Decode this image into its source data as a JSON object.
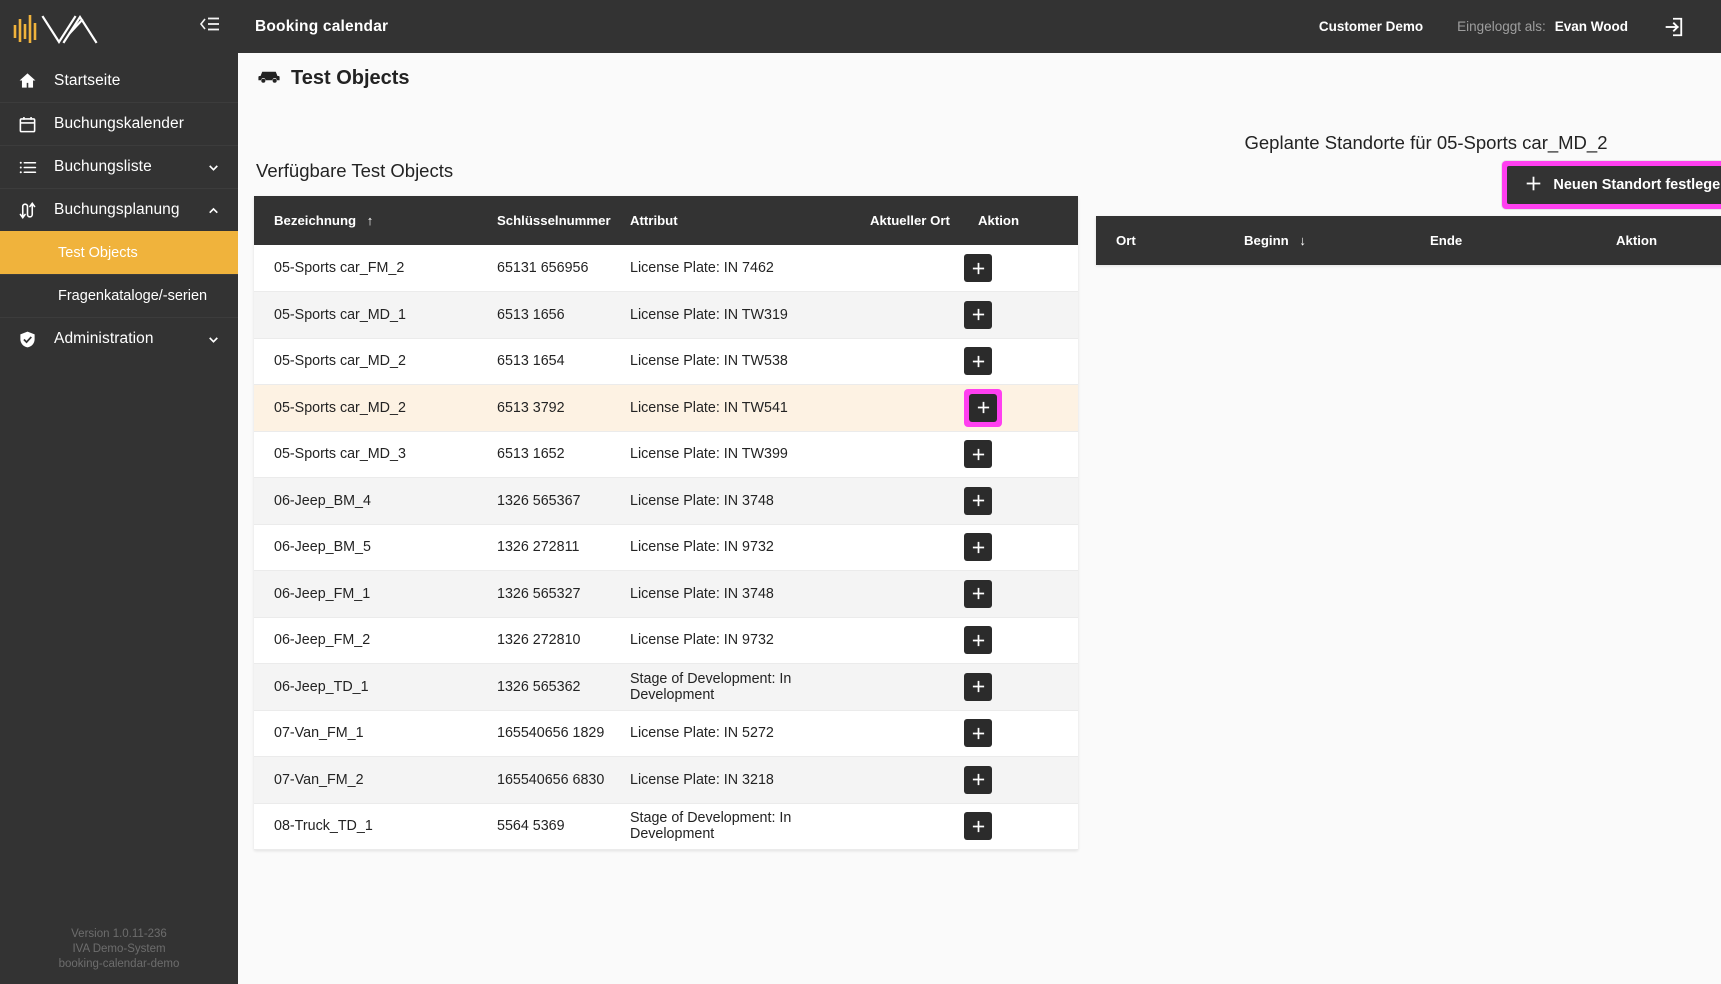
{
  "sidebar": {
    "logo_name": "iva-logo",
    "collapse_icon": "collapse-panel-icon",
    "items": [
      {
        "label": "Startseite",
        "icon": "home-icon",
        "chevron": ""
      },
      {
        "label": "Buchungskalender",
        "icon": "calendar-icon",
        "chevron": ""
      },
      {
        "label": "Buchungsliste",
        "icon": "list-icon",
        "chevron": "chevron-down-icon"
      },
      {
        "label": "Buchungsplanung",
        "icon": "swap-arrows-icon",
        "chevron": "chevron-up-icon"
      }
    ],
    "subitems": [
      {
        "label": "Test Objects",
        "active": true
      },
      {
        "label": "Fragenkataloge/-serien",
        "active": false
      }
    ],
    "admin": {
      "label": "Administration",
      "icon": "shield-check-icon",
      "chevron": "chevron-down-icon"
    },
    "footer": {
      "version": "Version 1.0.11-236",
      "system": "IVA Demo-System",
      "instance": "booking-calendar-demo"
    }
  },
  "topbar": {
    "title": "Booking calendar",
    "customer": "Customer Demo",
    "logged_in_label": "Eingeloggt als:",
    "username": "Evan Wood",
    "logout_icon": "logout-icon",
    "language_icon": "globe-icon"
  },
  "page": {
    "icon": "car-icon",
    "title": "Test Objects"
  },
  "left_panel": {
    "section_title": "Verfügbare Test Objects",
    "columns": [
      {
        "label": "Bezeichnung",
        "sort": "↑"
      },
      {
        "label": "Schlüsselnummer",
        "sort": ""
      },
      {
        "label": "Attribut",
        "sort": ""
      },
      {
        "label": "Aktueller Ort",
        "sort": ""
      },
      {
        "label": "Aktion",
        "sort": ""
      }
    ],
    "rows": [
      {
        "bezeichnung": "05-Sports car_FM_2",
        "schluesselnummer": "65131 656956",
        "attribut": "License Plate: IN 7462",
        "ort": "",
        "selected": false,
        "highlight_action": false
      },
      {
        "bezeichnung": "05-Sports car_MD_1",
        "schluesselnummer": "6513 1656",
        "attribut": "License Plate: IN TW319",
        "ort": "",
        "selected": false,
        "highlight_action": false
      },
      {
        "bezeichnung": "05-Sports car_MD_2",
        "schluesselnummer": "6513 1654",
        "attribut": "License Plate: IN TW538",
        "ort": "",
        "selected": false,
        "highlight_action": false
      },
      {
        "bezeichnung": "05-Sports car_MD_2",
        "schluesselnummer": "6513 3792",
        "attribut": "License Plate: IN TW541",
        "ort": "",
        "selected": true,
        "highlight_action": true
      },
      {
        "bezeichnung": "05-Sports car_MD_3",
        "schluesselnummer": "6513 1652",
        "attribut": "License Plate: IN TW399",
        "ort": "",
        "selected": false,
        "highlight_action": false
      },
      {
        "bezeichnung": "06-Jeep_BM_4",
        "schluesselnummer": "1326 565367",
        "attribut": "License Plate: IN 3748",
        "ort": "",
        "selected": false,
        "highlight_action": false
      },
      {
        "bezeichnung": "06-Jeep_BM_5",
        "schluesselnummer": "1326 272811",
        "attribut": "License Plate: IN 9732",
        "ort": "",
        "selected": false,
        "highlight_action": false
      },
      {
        "bezeichnung": "06-Jeep_FM_1",
        "schluesselnummer": "1326 565327",
        "attribut": "License Plate: IN 3748",
        "ort": "",
        "selected": false,
        "highlight_action": false
      },
      {
        "bezeichnung": "06-Jeep_FM_2",
        "schluesselnummer": "1326 272810",
        "attribut": "License Plate: IN 9732",
        "ort": "",
        "selected": false,
        "highlight_action": false
      },
      {
        "bezeichnung": "06-Jeep_TD_1",
        "schluesselnummer": "1326 565362",
        "attribut": "Stage of Development: In Development",
        "ort": "",
        "selected": false,
        "highlight_action": false
      },
      {
        "bezeichnung": "07-Van_FM_1",
        "schluesselnummer": "165540656 1829",
        "attribut": "License Plate: IN 5272",
        "ort": "",
        "selected": false,
        "highlight_action": false
      },
      {
        "bezeichnung": "07-Van_FM_2",
        "schluesselnummer": "165540656 6830",
        "attribut": "License Plate: IN 3218",
        "ort": "",
        "selected": false,
        "highlight_action": false
      },
      {
        "bezeichnung": "08-Truck_TD_1",
        "schluesselnummer": "5564 5369",
        "attribut": "Stage of Development: In Development",
        "ort": "",
        "selected": false,
        "highlight_action": false
      }
    ],
    "action_icon": "plus-icon"
  },
  "right_panel": {
    "title": "Geplante Standorte für 05-Sports car_MD_2",
    "new_location_button": {
      "label": "Neuen Standort festlegen",
      "icon": "plus-icon",
      "highlighted": true
    },
    "columns": [
      {
        "label": "Ort",
        "sort": ""
      },
      {
        "label": "Beginn",
        "sort": "↓"
      },
      {
        "label": "Ende",
        "sort": ""
      },
      {
        "label": "Aktion",
        "sort": ""
      }
    ],
    "rows": []
  },
  "colors": {
    "sidebar_bg": "#333333",
    "accent_active": "#f0b33c",
    "highlight_pink": "#ff3ff0",
    "selected_row": "#fdf2e3",
    "alt_row": "#f4f4f4",
    "header_bg": "#333333"
  }
}
